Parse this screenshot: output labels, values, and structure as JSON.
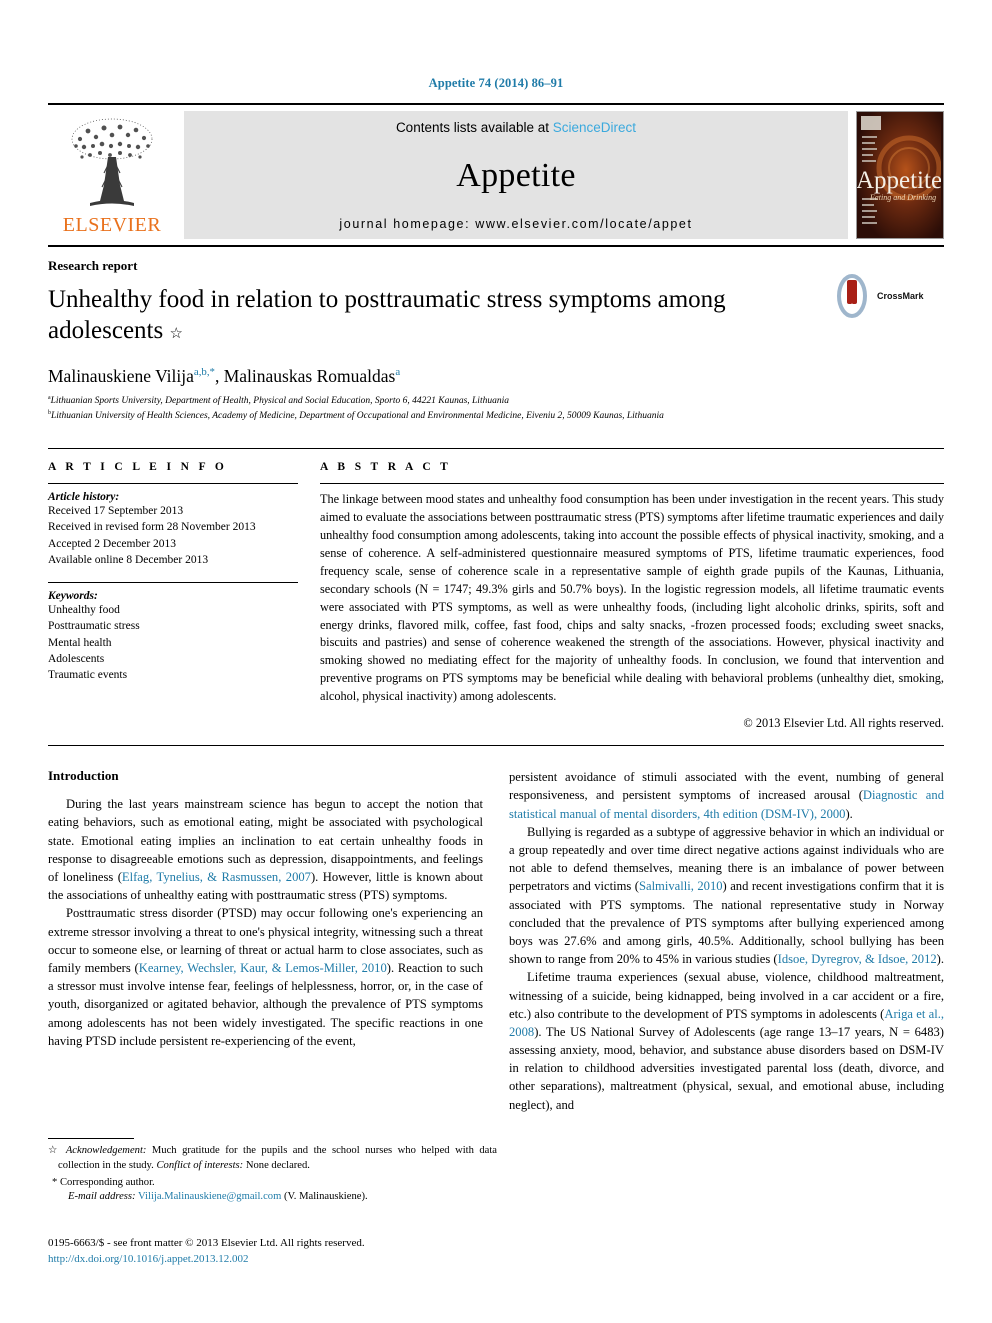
{
  "running_head": "Appetite 74 (2014) 86–91",
  "masthead": {
    "publisher_name": "ELSEVIER",
    "contents_prefix": "Contents lists available at ",
    "sciencedirect": "ScienceDirect",
    "journal_title": "Appetite",
    "homepage": "journal homepage: www.elsevier.com/locate/appet",
    "cover_title": "Appetite",
    "cover_subtitle": "Eating and Drinking"
  },
  "article": {
    "kind": "Research report",
    "title": "Unhealthy food in relation to posttraumatic stress symptoms among adolescents",
    "title_footnote_marker": "☆",
    "authors": [
      {
        "name": "Malinauskiene Vilija",
        "marks": "a,b,*"
      },
      {
        "name": "Malinauskas Romualdas",
        "marks": "a"
      }
    ],
    "affiliations": [
      {
        "mark": "a",
        "text": "Lithuanian Sports University, Department of Health, Physical and Social Education, Sporto 6, 44221 Kaunas, Lithuania"
      },
      {
        "mark": "b",
        "text": "Lithuanian University of Health Sciences, Academy of Medicine, Department of Occupational and Environmental Medicine, Eiveniu 2, 50009 Kaunas, Lithuania"
      }
    ],
    "crossmark_label": "CrossMark"
  },
  "article_info": {
    "heading": "A R T I C L E   I N F O",
    "history_label": "Article history:",
    "history": [
      "Received 17 September 2013",
      "Received in revised form 28 November 2013",
      "Accepted 2 December 2013",
      "Available online 8 December 2013"
    ],
    "keywords_label": "Keywords:",
    "keywords": [
      "Unhealthy food",
      "Posttraumatic stress",
      "Mental health",
      "Adolescents",
      "Traumatic events"
    ]
  },
  "abstract": {
    "heading": "A B S T R A C T",
    "text": "The linkage between mood states and unhealthy food consumption has been under investigation in the recent years. This study aimed to evaluate the associations between posttraumatic stress (PTS) symptoms after lifetime traumatic experiences and daily unhealthy food consumption among adolescents, taking into account the possible effects of physical inactivity, smoking, and a sense of coherence. A self-administered questionnaire measured symptoms of PTS, lifetime traumatic experiences, food frequency scale, sense of coherence scale in a representative sample of eighth grade pupils of the Kaunas, Lithuania, secondary schools (N = 1747; 49.3% girls and 50.7% boys). In the logistic regression models, all lifetime traumatic events were associated with PTS symptoms, as well as were unhealthy foods, (including light alcoholic drinks, spirits, soft and energy drinks, flavored milk, coffee, fast food, chips and salty snacks, -frozen processed foods; excluding sweet snacks, biscuits and pastries) and sense of coherence weakened the strength of the associations. However, physical inactivity and smoking showed no mediating effect for the majority of unhealthy foods. In conclusion, we found that intervention and preventive programs on PTS symptoms may be beneficial while dealing with behavioral problems (unhealthy diet, smoking, alcohol, physical inactivity) among adolescents.",
    "copyright": "© 2013 Elsevier Ltd. All rights reserved."
  },
  "introduction": {
    "heading": "Introduction",
    "left_paragraphs": [
      {
        "before": "During the last years mainstream science has begun to accept the notion that eating behaviors, such as emotional eating, might be associated with psychological state. Emotional eating implies an inclination to eat certain unhealthy foods in response to disagreeable emotions such as depression, disappointments, and feelings of loneliness (",
        "citation": "Elfag, Tynelius, & Rasmussen, 2007",
        "after": "). However, little is known about the associations of unhealthy eating with posttraumatic stress (PTS) symptoms."
      },
      {
        "before": "Posttraumatic stress disorder (PTSD) may occur following one's experiencing an extreme stressor involving a threat to one's physical integrity, witnessing such a threat occur to someone else, or learning of threat or actual harm to close associates, such as family members (",
        "citation": "Kearney, Wechsler, Kaur, & Lemos-Miller, 2010",
        "after": "). Reaction to such a stressor must involve intense fear, feelings of helplessness, horror, or, in the case of youth, disorganized or agitated behavior, although the prevalence of PTS symptoms among adolescents has not been widely investigated. The specific reactions in one having PTSD include persistent re-experiencing of the event,"
      }
    ],
    "right_paragraphs": [
      {
        "before": "persistent avoidance of stimuli associated with the event, numbing of general responsiveness, and persistent symptoms of increased arousal (",
        "citation": "Diagnostic and statistical manual of mental disorders, 4th edition (DSM-IV), 2000",
        "after": ").",
        "indent": false
      },
      {
        "before": "Bullying is regarded as a subtype of aggressive behavior in which an individual or a group repeatedly and over time direct negative actions against individuals who are not able to defend themselves, meaning there is an imbalance of power between perpetrators and victims (",
        "citation": "Salmivalli, 2010",
        "after": ") and recent investigations confirm that it is associated with PTS symptoms. The national representative study in Norway concluded that the prevalence of PTS symptoms after bullying experienced among boys was 27.6% and among girls, 40.5%. Additionally, school bullying has been shown to range from 20% to 45% in various studies (",
        "citation2": "Idsoe, Dyregrov, & Idsoe, 2012",
        "after2": ").",
        "indent": true
      },
      {
        "before": "Lifetime trauma experiences (sexual abuse, violence, childhood maltreatment, witnessing of a suicide, being kidnapped, being involved in a car accident or a fire, etc.) also contribute to the development of PTS symptoms in adolescents (",
        "citation": "Ariga et al., 2008",
        "after": "). The US National Survey of Adolescents (age range 13–17 years, N = 6483) assessing anxiety, mood, behavior, and substance abuse disorders based on DSM-IV in relation to childhood adversities investigated parental loss (death, divorce, and other separations), maltreatment (physical, sexual, and emotional abuse, including neglect), and",
        "indent": true
      }
    ]
  },
  "footnotes": {
    "acknowledgement_marker": "☆",
    "acknowledgement_label": "Acknowledgement:",
    "acknowledgement_text": " Much gratitude for the pupils and the school nurses who helped with data collection in the study. ",
    "conflict_label": "Conflict of interests:",
    "conflict_text": " None declared.",
    "corresponding_marker": "*",
    "corresponding_text": "Corresponding author.",
    "email_label": "E-mail address:",
    "email": "Vilija.Malinauskiene@gmail.com",
    "email_suffix": " (V. Malinauskiene)."
  },
  "footer": {
    "issn_line": "0195-6663/$ - see front matter © 2013 Elsevier Ltd. All rights reserved.",
    "doi": "http://dx.doi.org/10.1016/j.appet.2013.12.002"
  },
  "colors": {
    "link_blue": "#1f7ba8",
    "sciencedirect_blue": "#3ba9dd",
    "elsevier_orange": "#E9711C",
    "masthead_gray": "#e3e3e3"
  }
}
